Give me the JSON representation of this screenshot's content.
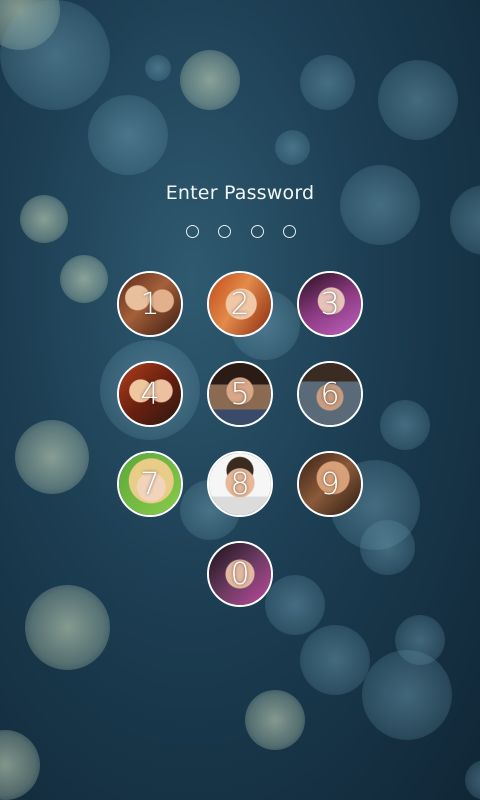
{
  "header": {
    "title": "Enter Password"
  },
  "pin_dots": {
    "total": 4,
    "filled": 0
  },
  "keypad": {
    "keys": [
      {
        "label": "1",
        "icon": "photo-avatar-icon"
      },
      {
        "label": "2",
        "icon": "photo-avatar-icon"
      },
      {
        "label": "3",
        "icon": "photo-avatar-icon"
      },
      {
        "label": "4",
        "icon": "photo-avatar-icon"
      },
      {
        "label": "5",
        "icon": "photo-avatar-icon"
      },
      {
        "label": "6",
        "icon": "photo-avatar-icon"
      },
      {
        "label": "7",
        "icon": "photo-avatar-icon"
      },
      {
        "label": "8",
        "icon": "photo-avatar-icon"
      },
      {
        "label": "9",
        "icon": "photo-avatar-icon"
      },
      {
        "label": "0",
        "icon": "photo-avatar-icon"
      }
    ]
  },
  "colors": {
    "text": "#f2f6f8",
    "ring": "#ffffff",
    "background": "#1c3d52"
  }
}
